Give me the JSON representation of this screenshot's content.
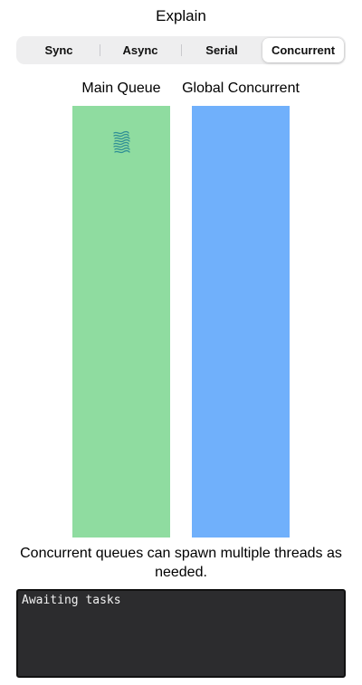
{
  "nav": {
    "title": "Explain"
  },
  "segments": [
    {
      "label": "Sync",
      "selected": false
    },
    {
      "label": "Async",
      "selected": false
    },
    {
      "label": "Serial",
      "selected": false
    },
    {
      "label": "Concurrent",
      "selected": true
    }
  ],
  "queues": {
    "main": {
      "label": "Main Queue",
      "color": "#8fdca0"
    },
    "global": {
      "label": "Global Concurrent",
      "color": "#70b0fb"
    }
  },
  "task_icon": {
    "icon": "wavy-task-icon",
    "color": "#2f8f95"
  },
  "caption": "Concurrent queues can spawn multiple threads as needed.",
  "console": {
    "text": "Awaiting tasks",
    "background": "#2c2c2e",
    "text_color": "#f2f2f2"
  }
}
